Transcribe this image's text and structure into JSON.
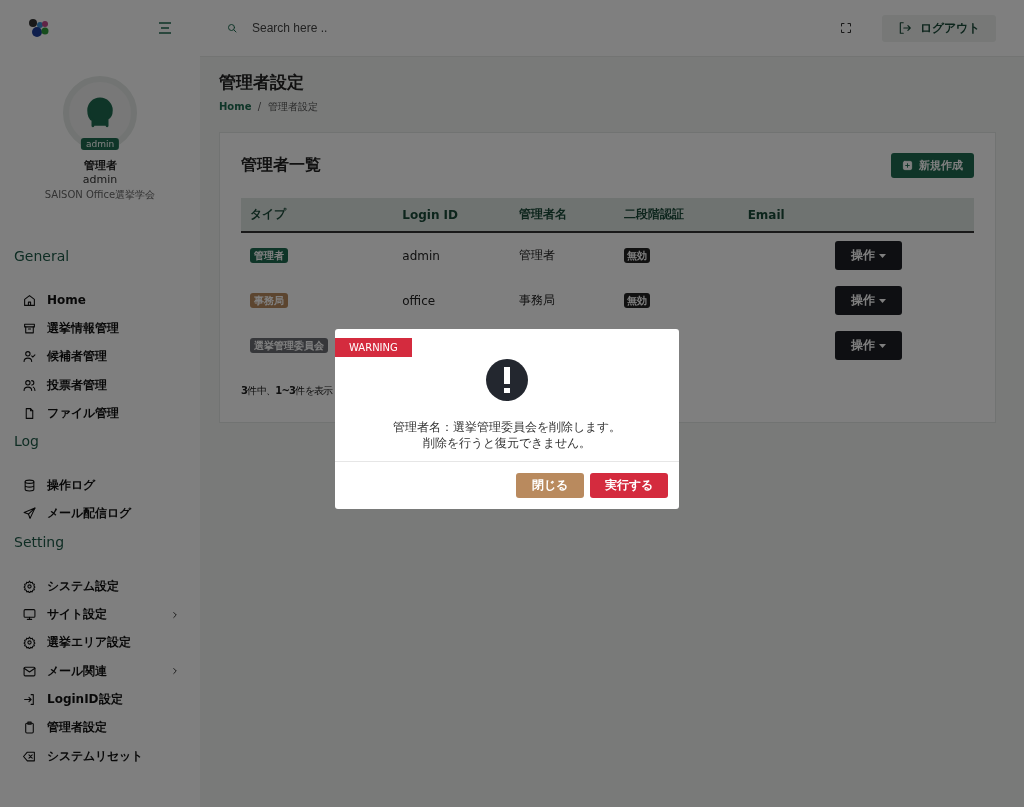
{
  "topbar": {
    "search_placeholder": "Search here ..",
    "logout": "ログアウト"
  },
  "profile": {
    "badge": "admin",
    "name": "管理者",
    "login": "admin",
    "org": "SAISON Office選挙学会"
  },
  "sidebar": [
    {
      "heading": "General",
      "items": [
        {
          "label": "Home",
          "expandable": false
        },
        {
          "label": "選挙情報管理",
          "expandable": false
        },
        {
          "label": "候補者管理",
          "expandable": false
        },
        {
          "label": "投票者管理",
          "expandable": false
        },
        {
          "label": "ファイル管理",
          "expandable": false
        }
      ]
    },
    {
      "heading": "Log",
      "items": [
        {
          "label": "操作ログ",
          "expandable": false
        },
        {
          "label": "メール配信ログ",
          "expandable": false
        }
      ]
    },
    {
      "heading": "Setting",
      "items": [
        {
          "label": "システム設定",
          "expandable": false
        },
        {
          "label": "サイト設定",
          "expandable": true
        },
        {
          "label": "選挙エリア設定",
          "expandable": false
        },
        {
          "label": "メール関連",
          "expandable": true
        },
        {
          "label": "LoginID設定",
          "expandable": false
        },
        {
          "label": "管理者設定",
          "expandable": false
        },
        {
          "label": "システムリセット",
          "expandable": false
        }
      ]
    }
  ],
  "page": {
    "title": "管理者設定",
    "breadcrumb": [
      "Home",
      "管理者設定"
    ],
    "breadcrumb_separator": "/"
  },
  "card": {
    "title": "管理者一覧",
    "new_button": "新規作成",
    "table": {
      "columns": [
        "タイプ",
        "Login ID",
        "管理者名",
        "二段階認証",
        "Email"
      ],
      "rows": [
        {
          "type": "管理者",
          "color": "#0f3528",
          "login_id": "admin",
          "name": "管理者",
          "two_factor": "無効",
          "action": "操作"
        },
        {
          "type": "事務局",
          "color": "#5c452f",
          "login_id": "office",
          "name": "事務局",
          "two_factor": "無効",
          "action": "操作"
        },
        {
          "type": "選挙管理委員会",
          "color": "#36373a",
          "action": "操作"
        }
      ]
    },
    "summary": "**3**件中、**1~3**件を表示"
  },
  "modal": {
    "label": "WARNING",
    "message": [
      "管理者名：選挙管理委員会を削除します。",
      "削除を行うと復元できません。"
    ],
    "close": "閉じる",
    "confirm": "実行する"
  }
}
